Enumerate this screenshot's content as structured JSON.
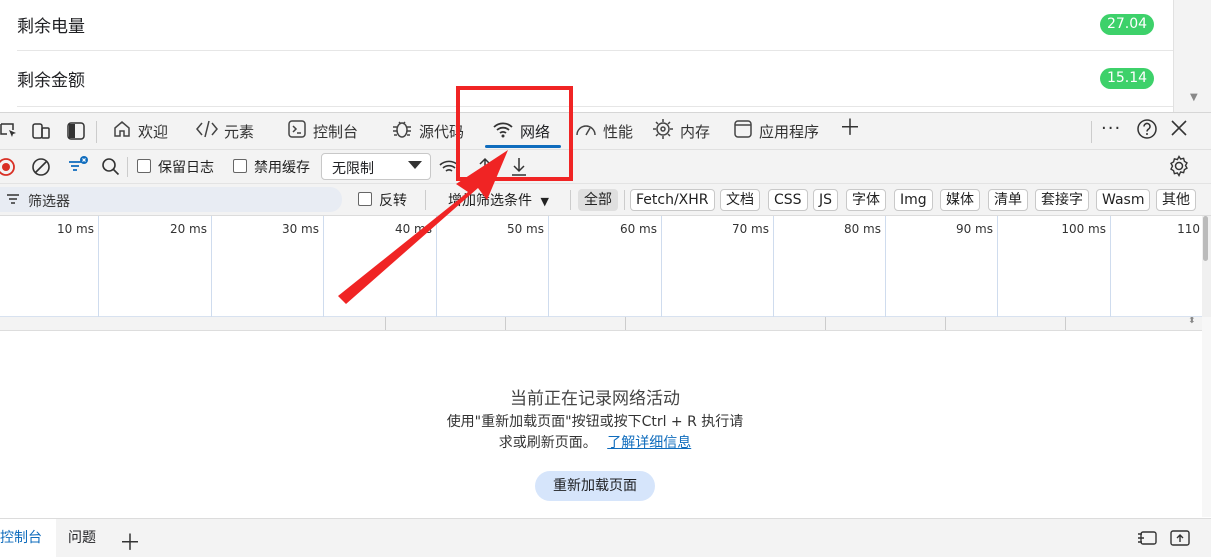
{
  "page": {
    "rows": [
      {
        "label": "剩余电量",
        "value": "27.04"
      },
      {
        "label": "剩余金额",
        "value": "15.14"
      }
    ]
  },
  "tabs": [
    {
      "label": "欢迎",
      "icon": "home-icon"
    },
    {
      "label": "元素",
      "icon": "code-icon"
    },
    {
      "label": "控制台",
      "icon": "terminal-icon"
    },
    {
      "label": "源代码",
      "icon": "bug-icon"
    },
    {
      "label": "网络",
      "icon": "wifi-icon"
    },
    {
      "label": "性能",
      "icon": "gauge-icon"
    },
    {
      "label": "内存",
      "icon": "chip-icon"
    },
    {
      "label": "应用程序",
      "icon": "window-icon"
    }
  ],
  "toolbar": {
    "preserve_log": "保留日志",
    "disable_cache": "禁用缓存",
    "throttle": "无限制"
  },
  "filter": {
    "placeholder": "筛选器",
    "invert": "反转",
    "more_filters": "增加筛选条件"
  },
  "types": [
    "全部",
    "Fetch/XHR",
    "文档",
    "CSS",
    "JS",
    "字体",
    "Img",
    "媒体",
    "清单",
    "套接字",
    "Wasm",
    "其他"
  ],
  "timeline": {
    "ticks": [
      "10 ms",
      "20 ms",
      "30 ms",
      "40 ms",
      "50 ms",
      "60 ms",
      "70 ms",
      "80 ms",
      "90 ms",
      "100 ms",
      "110"
    ]
  },
  "empty": {
    "title": "当前正在记录网络活动",
    "desc_line1": "使用\"重新加载页面\"按钮或按下Ctrl + R 执行请",
    "desc_line2": "求或刷新页面。",
    "learn_more": "了解详细信息",
    "reload": "重新加载页面"
  },
  "drawer": {
    "console": "控制台",
    "issues": "问题"
  },
  "colors": {
    "accent": "#0f6cbd",
    "badge_green": "#3dd16a",
    "annotation_red": "#f02424"
  }
}
